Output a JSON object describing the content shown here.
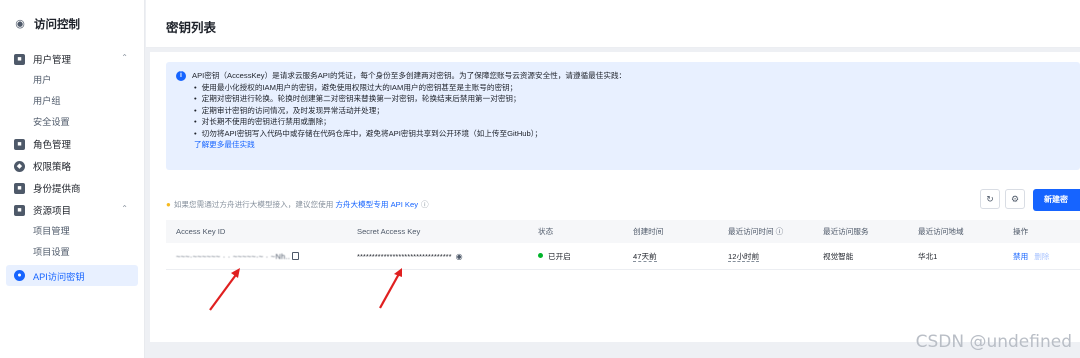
{
  "sidebar": {
    "title": "访问控制",
    "groups": [
      {
        "label": "用户管理",
        "items": [
          "用户",
          "用户组",
          "安全设置"
        ]
      },
      {
        "label": "角色管理"
      },
      {
        "label": "权限策略"
      },
      {
        "label": "身份提供商"
      },
      {
        "label": "资源项目",
        "items": [
          "项目管理",
          "项目设置"
        ]
      }
    ],
    "active_item": "API访问密钥"
  },
  "page": {
    "title": "密钥列表"
  },
  "notice": {
    "intro": "API密钥（AccessKey）是请求云服务API的凭证，每个身份至多创建两对密钥。为了保障您账号云资源安全性，请遵循最佳实践：",
    "bullets": [
      "使用最小化授权的IAM用户的密钥，避免使用权限过大的IAM用户的密钥甚至是主账号的密钥；",
      "定期对密钥进行轮换。轮换时创建第二对密钥来替换第一对密钥，轮换结束后禁用第一对密钥；",
      "定期审计密钥的访问情况，及时发现异常活动并处理；",
      "对长期不使用的密钥进行禁用或删除；",
      "切勿将API密钥写入代码中或存储在代码仓库中，避免将API密钥共享到公开环境（如上传至GitHub）；"
    ],
    "link": "了解更多最佳实践"
  },
  "hint": {
    "text": "如果您需通过方舟进行大模型接入，建议您使用",
    "link": "方舟大模型专用 API Key"
  },
  "toolbar": {
    "new_button": "新建密"
  },
  "table": {
    "headers": [
      "Access Key ID",
      "Secret Access Key",
      "状态",
      "创建时间",
      "最近访问时间 ⓘ",
      "最近访问服务",
      "最近访问地域",
      "操作"
    ],
    "rows": [
      {
        "access_key_id": "~~~·~~~~~~ · · ~~~~~·~ · ~Nh..",
        "secret": "********************************",
        "status": "已开启",
        "created": "47天前",
        "last_access": "12小时前",
        "service": "视觉智能",
        "region": "华北1",
        "action_disable": "禁用",
        "action_delete": "删除"
      }
    ]
  },
  "watermark": "CSDN @undefined",
  "colors": {
    "accent": "#1664ff",
    "status_on": "#00b42a",
    "arrow": "#e02020"
  }
}
